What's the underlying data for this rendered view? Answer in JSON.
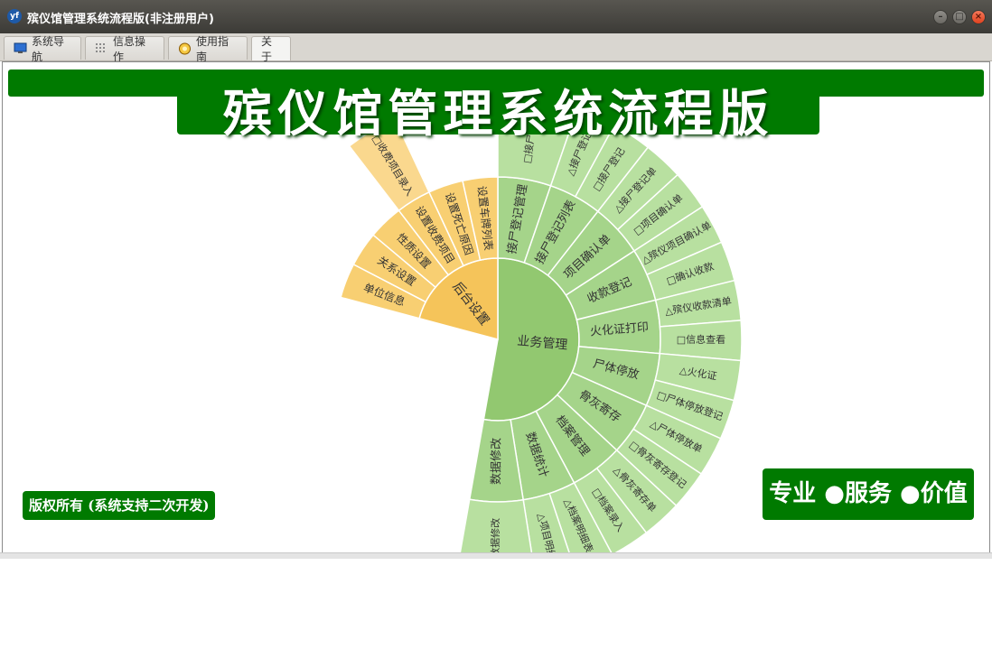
{
  "window": {
    "title": "殡仪馆管理系统流程版(非注册用户)",
    "app_icon": "yf"
  },
  "controls": {
    "minimize": "–",
    "maximize": "□",
    "close": "×"
  },
  "tabs": [
    {
      "label": "系统导航",
      "icon": "monitor-icon"
    },
    {
      "label": "信息操作",
      "icon": "grid-icon"
    },
    {
      "label": "使用指南",
      "icon": "help-icon"
    },
    {
      "label": "关于",
      "icon": ""
    }
  ],
  "banner": {
    "title": "殡仪馆管理系统流程版"
  },
  "footer": {
    "copyright": "版权所有 (系统支持二次开发)",
    "slogan": "专业 ●服务 ●价值"
  },
  "colors": {
    "green": "#007a00",
    "ring_green_1": "#92c870",
    "ring_green_2": "#a5d48a",
    "ring_green_3": "#b8e0a0",
    "ring_orange_1": "#f5c45a",
    "ring_orange_2": "#f8cf72",
    "ring_orange_3": "#fad88e"
  },
  "sunburst": {
    "business": {
      "label": "业务管理",
      "modules": [
        {
          "label": "接尸登记管理",
          "items": [
            "□接尸登记"
          ]
        },
        {
          "label": "接尸登记列表",
          "items": [
            "△接尸登记",
            "□接尸登记"
          ]
        },
        {
          "label": "项目确认单",
          "items": [
            "△接尸登记单",
            "□项目确认单"
          ]
        },
        {
          "label": "收款登记",
          "items": [
            "△殡仪项目确认单",
            "□确认收款"
          ]
        },
        {
          "label": "火化证打印",
          "items": [
            "△殡仪收款清单",
            "□信息查看"
          ]
        },
        {
          "label": "尸体停放",
          "items": [
            "△火化证",
            "□尸体停放登记"
          ]
        },
        {
          "label": "骨灰寄存",
          "items": [
            "△尸体停放单",
            "□骨灰寄存登记"
          ]
        },
        {
          "label": "档案管理",
          "items": [
            "△骨灰寄存单",
            "□档案录入"
          ]
        },
        {
          "label": "数据统计",
          "items": [
            "△档案明细表",
            "△项目明细"
          ]
        },
        {
          "label": "数据修改",
          "items": [
            "□数据修改"
          ]
        }
      ]
    },
    "settings": {
      "label": "后台设置",
      "modules": [
        {
          "label": "单位信息",
          "items": []
        },
        {
          "label": "关系设置",
          "items": []
        },
        {
          "label": "性质设置",
          "items": []
        },
        {
          "label": "设置收费项目",
          "items": [
            "□收费项目录入"
          ]
        },
        {
          "label": "设置死亡原因",
          "items": []
        },
        {
          "label": "设置车牌列表",
          "items": []
        }
      ]
    }
  }
}
